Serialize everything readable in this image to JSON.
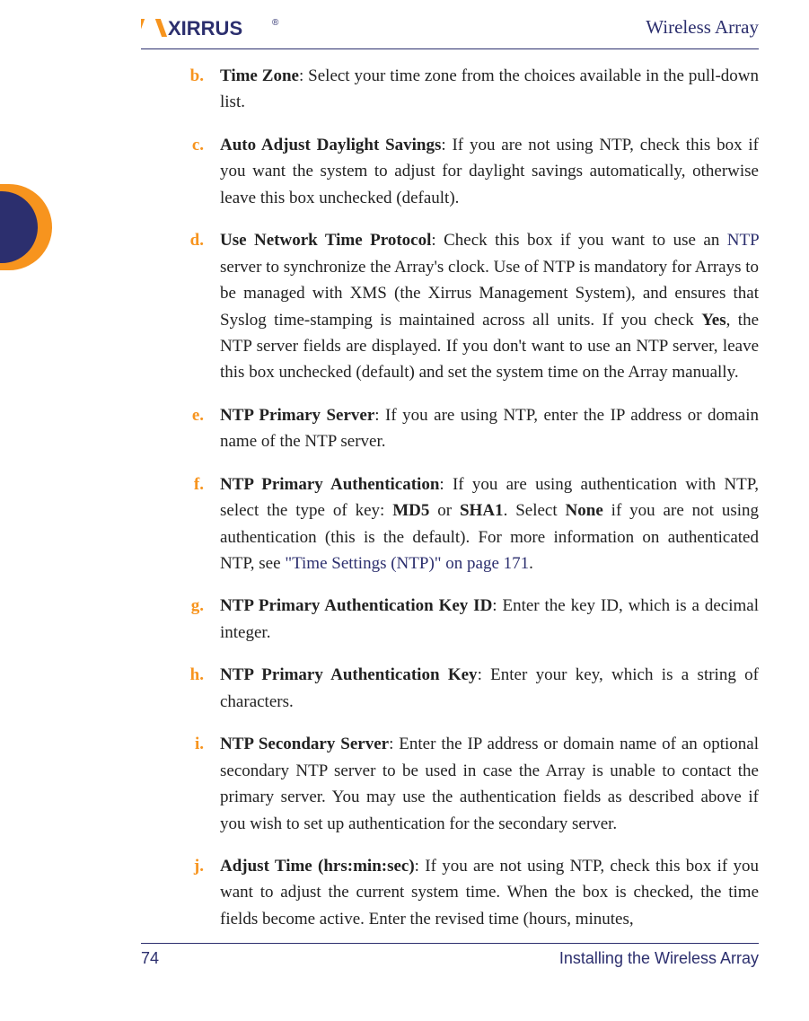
{
  "header": {
    "doc_title": "Wireless Array"
  },
  "footer": {
    "page_number": "74",
    "chapter": "Installing the Wireless Array"
  },
  "logo": {
    "brand": "XIRRUS",
    "mark": "®"
  },
  "items": {
    "b": {
      "marker": "b.",
      "title": "Time Zone",
      "rest": ": Select your time zone from the choices available in the pull-down list."
    },
    "c": {
      "marker": "c.",
      "title": "Auto Adjust Daylight Savings",
      "rest": ": If you are not using NTP, check this box if you want the system to adjust for daylight savings automatically, otherwise leave this box unchecked (default)."
    },
    "d": {
      "marker": "d.",
      "title": "Use Network Time Protocol",
      "pre": ": Check this box if you want to use an ",
      "link": "NTP",
      "mid": " server to synchronize the Array's clock. Use of NTP is mandatory for Arrays to be managed with XMS (the Xirrus Management System), and ensures that Syslog time-stamping is maintained across all units. If you check ",
      "bold_yes": "Yes",
      "post": ", the NTP server fields are displayed. If you don't want to use an NTP server, leave this box unchecked (default) and set the system time on the Array manually."
    },
    "e": {
      "marker": "e.",
      "title": "NTP Primary Server",
      "rest": ": If you are using NTP, enter the IP address or domain name of the NTP server."
    },
    "f": {
      "marker": "f.",
      "title": "NTP Primary Authentication",
      "pre": ": If you are using authentication with NTP, select the type of key: ",
      "md5": "MD5",
      "or": " or ",
      "sha1": "SHA1",
      "mid": ". Select ",
      "none": "None",
      "post1": " if you are not using authentication (this is the default). For more information on authenticated NTP, see ",
      "link": "\"Time Settings (NTP)\" on page 171",
      "post2": "."
    },
    "g": {
      "marker": "g.",
      "title": "NTP Primary Authentication Key ID",
      "rest": ": Enter the key ID, which is a decimal integer."
    },
    "h": {
      "marker": "h.",
      "title": "NTP Primary Authentication Key",
      "rest": ": Enter your key, which is a string of characters."
    },
    "i": {
      "marker": "i.",
      "title": "NTP Secondary Server",
      "rest": ": Enter the IP address or domain name of an optional secondary NTP server to be used in case the Array is unable to contact the primary server. You may use the authentication fields as described above if you wish to set up authentication for the secondary server."
    },
    "j": {
      "marker": "j.",
      "title": "Adjust Time (hrs:min:sec)",
      "rest": ": If you are not using NTP, check this box if you want to adjust the current system time. When the box is checked, the time fields become active. Enter the revised time (hours, minutes,"
    }
  }
}
